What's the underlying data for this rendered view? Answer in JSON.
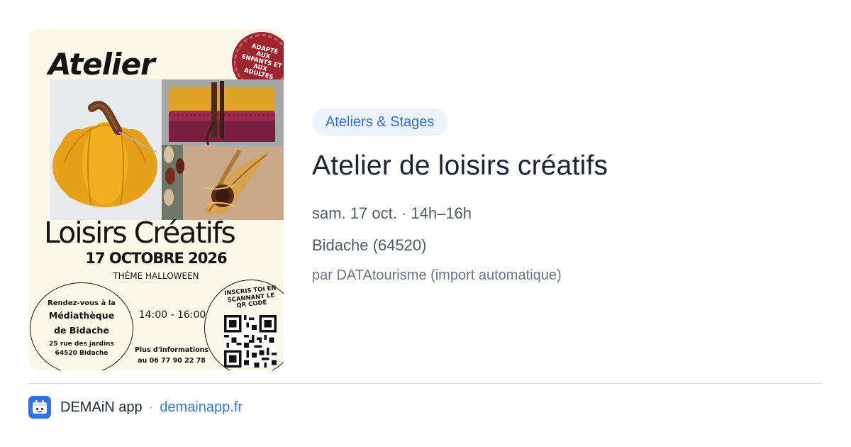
{
  "poster": {
    "title_line1": "Atelier",
    "seal_text": "ADAPTÉ AUX ENFANTS ET AUX ADULTES",
    "title_line2": "Loisirs Créatifs",
    "date": "17 OCTOBRE 2026",
    "theme": "THÈME HALLOWEEN",
    "rendezvous": "Rendez-vous à la",
    "venue_line1": "Médiathèque",
    "venue_line2": "de Bidache",
    "address_line1": "25 rue des jardins",
    "address_line2": "64520 Bidache",
    "hours": "14:00 - 16:00",
    "info_line1": "Plus d'informations",
    "info_line2": "au 06 77 90 22 78",
    "qr_text": "INSCRIS TOI EN SCANNANT LE QR CODE"
  },
  "event": {
    "category": "Ateliers & Stages",
    "title": "Atelier de loisirs créatifs",
    "when": "sam. 17 oct. · 14h–16h",
    "where": "Bidache (64520)",
    "source": "par DATAtourisme (import automatique)"
  },
  "footer": {
    "app_name": "DEMAiN app",
    "separator": "·",
    "link": "demainapp.fr",
    "app_icon": "demain-app-icon"
  },
  "colors": {
    "accent": "#2f6fd8",
    "badge_bg": "#edf3fc",
    "poster_bg": "#fbf8ea",
    "seal": "#9e2430"
  }
}
